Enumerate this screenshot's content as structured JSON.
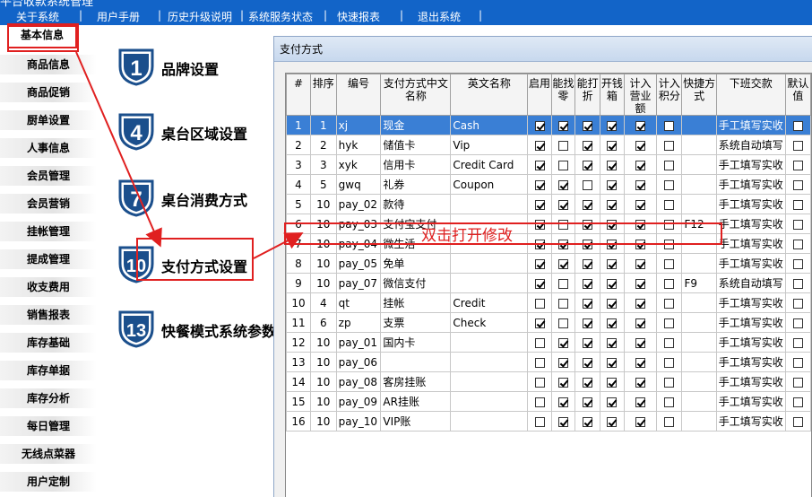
{
  "topbar": {
    "cut_title": "平台收款系统管理",
    "items": [
      "关于系统",
      "用户手册",
      "历史升级说明",
      "系统服务状态",
      "快速报表",
      "退出系统"
    ]
  },
  "sidebar": {
    "items": [
      "基本信息",
      "商品信息",
      "商品促销",
      "厨单设置",
      "人事信息",
      "会员管理",
      "会员营销",
      "挂帐管理",
      "提成管理",
      "收支费用",
      "销售报表",
      "库存基础",
      "库存单据",
      "库存分析",
      "每日管理",
      "无线点菜器",
      "用户定制"
    ]
  },
  "main_menu": [
    {
      "num": "1",
      "label": "品牌设置"
    },
    {
      "num": "4",
      "label": "桌台区域设置"
    },
    {
      "num": "7",
      "label": "桌台消费方式"
    },
    {
      "num": "10",
      "label": "支付方式设置"
    },
    {
      "num": "13",
      "label": "快餐模式系统参数"
    }
  ],
  "window": {
    "title": "支付方式",
    "columns": [
      "#",
      "排序",
      "编号",
      "支付方式中文名称",
      "英文名称",
      "启用",
      "能找零",
      "能打折",
      "开钱箱",
      "计入营业额",
      "计入积分",
      "快捷方式",
      "下班交款",
      "默认值"
    ],
    "rows": [
      {
        "n": "1",
        "sort": "1",
        "code": "xj",
        "cn": "现金",
        "en": "Cash",
        "flags": [
          1,
          1,
          1,
          1,
          1,
          0
        ],
        "key": "",
        "settle": "手工填写实收",
        "sel": true
      },
      {
        "n": "2",
        "sort": "2",
        "code": "hyk",
        "cn": "储值卡",
        "en": "Vip",
        "flags": [
          1,
          0,
          1,
          1,
          1,
          0
        ],
        "key": "",
        "settle": "系统自动填写"
      },
      {
        "n": "3",
        "sort": "3",
        "code": "xyk",
        "cn": "信用卡",
        "en": "Credit Card",
        "flags": [
          1,
          0,
          1,
          1,
          1,
          0
        ],
        "key": "",
        "settle": "手工填写实收"
      },
      {
        "n": "4",
        "sort": "5",
        "code": "gwq",
        "cn": "礼券",
        "en": "Coupon",
        "flags": [
          1,
          1,
          0,
          1,
          1,
          0
        ],
        "key": "",
        "settle": "手工填写实收"
      },
      {
        "n": "5",
        "sort": "10",
        "code": "pay_02",
        "cn": "款待",
        "en": "",
        "flags": [
          1,
          1,
          1,
          1,
          1,
          0
        ],
        "key": "",
        "settle": "手工填写实收"
      },
      {
        "n": "6",
        "sort": "10",
        "code": "pay_03",
        "cn": "支付宝支付",
        "en": "",
        "flags": [
          1,
          0,
          1,
          1,
          1,
          0
        ],
        "key": "F12",
        "settle": "手工填写实收"
      },
      {
        "n": "7",
        "sort": "10",
        "code": "pay_04",
        "cn": "微生活",
        "en": "",
        "flags": [
          1,
          1,
          1,
          1,
          1,
          0
        ],
        "key": "",
        "settle": "手工填写实收"
      },
      {
        "n": "8",
        "sort": "10",
        "code": "pay_05",
        "cn": "免单",
        "en": "",
        "flags": [
          1,
          1,
          1,
          1,
          1,
          0
        ],
        "key": "",
        "settle": "手工填写实收"
      },
      {
        "n": "9",
        "sort": "10",
        "code": "pay_07",
        "cn": "微信支付",
        "en": "",
        "flags": [
          1,
          0,
          1,
          1,
          1,
          0
        ],
        "key": "F9",
        "settle": "系统自动填写"
      },
      {
        "n": "10",
        "sort": "4",
        "code": "qt",
        "cn": "挂帐",
        "en": "Credit",
        "flags": [
          0,
          0,
          1,
          1,
          1,
          0
        ],
        "key": "",
        "settle": "手工填写实收"
      },
      {
        "n": "11",
        "sort": "6",
        "code": "zp",
        "cn": "支票",
        "en": "Check",
        "flags": [
          1,
          0,
          1,
          1,
          1,
          0
        ],
        "key": "",
        "settle": "手工填写实收"
      },
      {
        "n": "12",
        "sort": "10",
        "code": "pay_01",
        "cn": "国内卡",
        "en": "",
        "flags": [
          0,
          1,
          1,
          1,
          1,
          0
        ],
        "key": "",
        "settle": "手工填写实收"
      },
      {
        "n": "13",
        "sort": "10",
        "code": "pay_06",
        "cn": "",
        "en": "",
        "flags": [
          0,
          1,
          1,
          1,
          1,
          0
        ],
        "key": "",
        "settle": "手工填写实收"
      },
      {
        "n": "14",
        "sort": "10",
        "code": "pay_08",
        "cn": "客房挂账",
        "en": "",
        "flags": [
          0,
          1,
          1,
          1,
          1,
          0
        ],
        "key": "",
        "settle": "手工填写实收"
      },
      {
        "n": "15",
        "sort": "10",
        "code": "pay_09",
        "cn": "AR挂账",
        "en": "",
        "flags": [
          0,
          1,
          1,
          1,
          1,
          0
        ],
        "key": "",
        "settle": "手工填写实收"
      },
      {
        "n": "16",
        "sort": "10",
        "code": "pay_10",
        "cn": "VIP账",
        "en": "",
        "flags": [
          0,
          1,
          1,
          1,
          1,
          0
        ],
        "key": "",
        "settle": "手工填写实收"
      }
    ]
  },
  "annotation": {
    "text": "双击打开修改",
    "color": "#e02020"
  },
  "colors": {
    "topbar": "#1264c8",
    "selected_row": "#3a7fd5",
    "annotation": "#e02020",
    "badge": "#1b4f8c"
  }
}
